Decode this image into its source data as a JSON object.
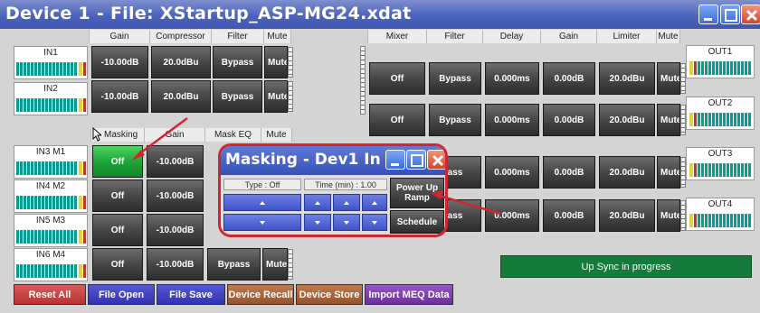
{
  "window": {
    "title": "Device 1  -  File: XStartup_ASP-MG24.xdat"
  },
  "input_grid": {
    "headers": [
      "Gain",
      "Compressor",
      "Filter",
      "Mute"
    ],
    "rows": [
      {
        "channel": "IN1",
        "gain": "-10.00dB",
        "compressor": "20.0dBu",
        "filter": "Bypass",
        "mute": "Mute"
      },
      {
        "channel": "IN2",
        "gain": "-10.00dB",
        "compressor": "20.0dBu",
        "filter": "Bypass",
        "mute": "Mute"
      }
    ]
  },
  "mic_grid": {
    "headers": [
      "Masking",
      "Gain",
      "Mask EQ",
      "Mute"
    ],
    "rows": [
      {
        "channel": "IN3 M1",
        "masking": "Off",
        "gain": "-10.00dB",
        "mask_eq": "",
        "mute": ""
      },
      {
        "channel": "IN4 M2",
        "masking": "Off",
        "gain": "-10.00dB",
        "mask_eq": "",
        "mute": ""
      },
      {
        "channel": "IN5 M3",
        "masking": "Off",
        "gain": "-10.00dB",
        "mask_eq": "",
        "mute": ""
      },
      {
        "channel": "IN6 M4",
        "masking": "Off",
        "gain": "-10.00dB",
        "mask_eq": "Bypass",
        "mute": "Mute"
      }
    ]
  },
  "output_grid": {
    "headers": [
      "Mixer",
      "Filter",
      "Delay",
      "Gain",
      "Limiter",
      "Mute"
    ],
    "rows": [
      {
        "channel": "OUT1",
        "mixer": "Off",
        "filter": "Bypass",
        "delay": "0.000ms",
        "gain": "0.00dB",
        "limiter": "20.0dBu",
        "mute": "Mute"
      },
      {
        "channel": "OUT2",
        "mixer": "Off",
        "filter": "Bypass",
        "delay": "0.000ms",
        "gain": "0.00dB",
        "limiter": "20.0dBu",
        "mute": "Mute"
      },
      {
        "channel": "OUT3",
        "mixer": "",
        "filter": "ass",
        "delay": "0.000ms",
        "gain": "0.00dB",
        "limiter": "20.0dBu",
        "mute": "Mute"
      },
      {
        "channel": "OUT4",
        "mixer": "",
        "filter": "ass",
        "delay": "0.000ms",
        "gain": "0.00dB",
        "limiter": "20.0dBu",
        "mute": "Mute"
      }
    ]
  },
  "dialog": {
    "title": "Masking - Dev1 In ...",
    "type_label": "Type : Off",
    "time_label": "Time (min) : 1.00",
    "power_up_label": "Power Up Ramp",
    "schedule_label": "Schedule"
  },
  "bottom_buttons": {
    "reset_all": "Reset All",
    "file_open": "File Open",
    "file_save": "File Save",
    "device_recall": "Device Recall",
    "device_store": "Device Store",
    "import_meq": "Import MEQ Data"
  },
  "status": {
    "text": "Up Sync in progress"
  },
  "colors": {
    "title_blue": "#4b63bd",
    "active_green": "#1fa63a",
    "reset_red": "#c23d3d",
    "file_blue": "#3b3cc1",
    "device_brown": "#a5623a",
    "import_purple": "#7d3da8",
    "status_green": "#157a3a",
    "annotation_red": "#d1262f"
  },
  "icons": [
    "minimize-icon",
    "maximize-icon",
    "close-icon",
    "up-arrow-icon",
    "down-arrow-icon",
    "mouse-cursor-icon"
  ]
}
